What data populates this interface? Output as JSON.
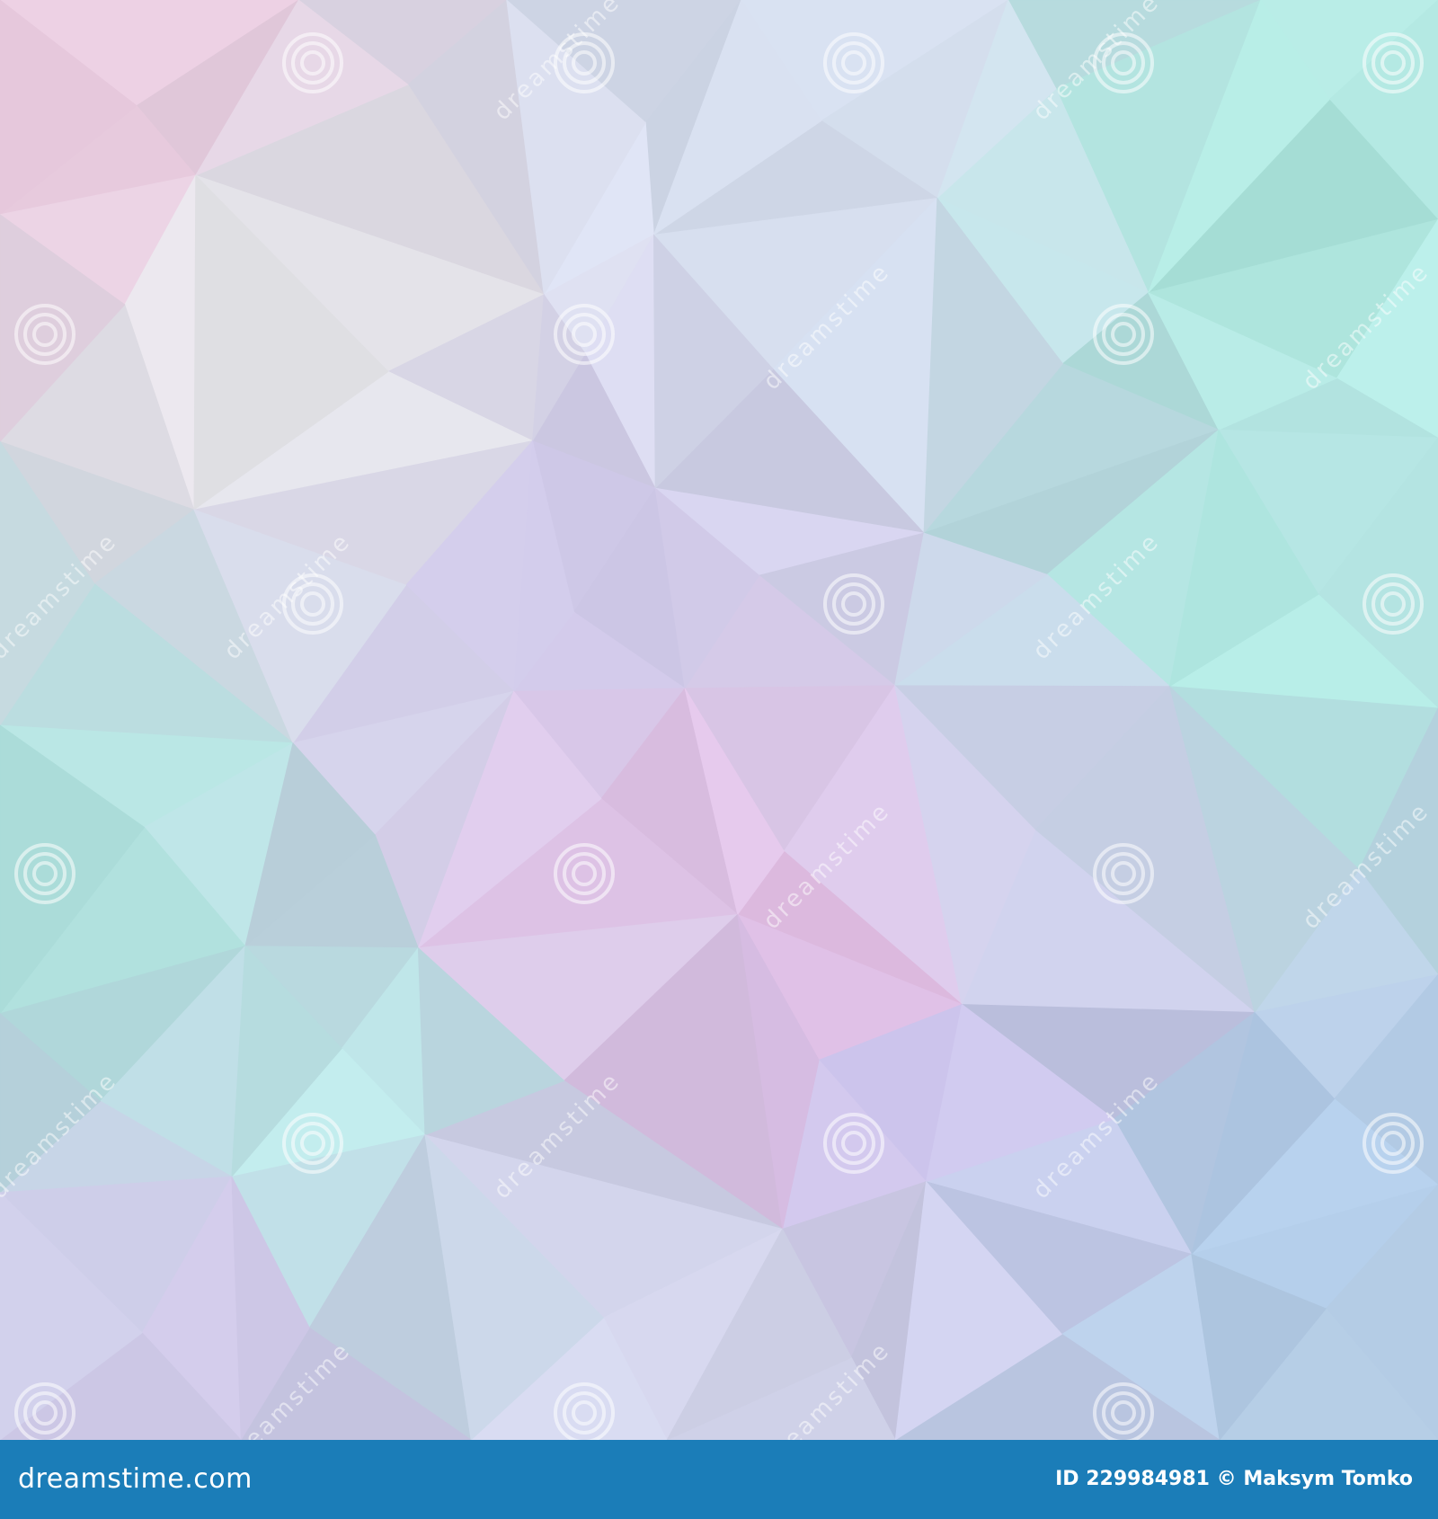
{
  "watermark": {
    "brand_text": "dreamstime",
    "icon": "spiral-logo-icon"
  },
  "footer": {
    "site": "dreamstime.com",
    "id_label": "ID 229984981",
    "copyright_symbol": "©",
    "author": "Maksym Tomko",
    "background_color": "#1b7db8",
    "text_color": "#ffffff"
  },
  "palette": {
    "mint": "#a8e6df",
    "lavender": "#c8c3e6",
    "pink": "#e9c6e4",
    "pale_grey": "#dfe3ea",
    "light_blue": "#b9cde6",
    "aqua": "#bdeee8"
  }
}
